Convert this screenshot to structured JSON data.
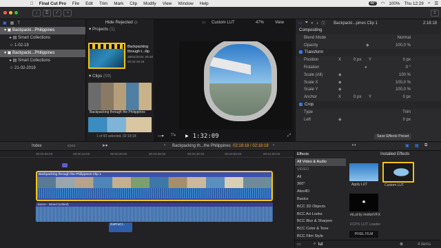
{
  "menubar": {
    "app": "Final Cut Pro",
    "items": [
      "File",
      "Edit",
      "Trim",
      "Mark",
      "Clip",
      "Modify",
      "View",
      "Window",
      "Help"
    ],
    "battery": "44°",
    "zoom": "100%",
    "clock": "Thu 12:29"
  },
  "library": {
    "items": [
      "Backpacki...Philippines",
      "Smart Collections",
      "1-02-19",
      "Backpacki...Philippines",
      "Smart Collections",
      "21-02-2019"
    ]
  },
  "browser": {
    "filter": "Hide Rejected",
    "projects_label": "Projects",
    "projects_count": "(1)",
    "project": {
      "name": "Backpacking through t...ilip",
      "date": "28/02/2019, 06:30",
      "duration": "00:02:18:18"
    },
    "clips_label": "Clips",
    "clips_count": "(59)",
    "clip_label": "Backpacking through the Philippines",
    "selection_info": "1 of 60 selected, 02:18:18"
  },
  "viewer": {
    "title": "Custom LUT",
    "zoom": "47%",
    "view": "View",
    "timecode": "1:32:09"
  },
  "inspector": {
    "clip_title": "Backpacki...pines Clip 1",
    "duration": "2:18:18",
    "compositing": "Compositing",
    "blend_mode_label": "Blend Mode",
    "blend_mode_value": "Normal",
    "opacity_label": "Opacity",
    "opacity_value": "100,0 %",
    "transform": "Transform",
    "position_label": "Position",
    "x_label": "X",
    "x_val": "0 px",
    "y_label": "Y",
    "y_val": "0 px",
    "rotation_label": "Rotation",
    "rotation_val": "0 °",
    "scale_all_label": "Scale (All)",
    "scale_all_val": "100 %",
    "scale_x_label": "Scale X",
    "scale_x_val": "100,0 %",
    "scale_y_label": "Scale Y",
    "scale_y_val": "100,0 %",
    "anchor_label": "Anchor",
    "anchor_x": "0 px",
    "anchor_y": "0 px",
    "crop": "Crop",
    "type_label": "Type",
    "type_val": "Trim",
    "left_label": "Left",
    "left_val": "0 px",
    "save_preset": "Save Effects Preset"
  },
  "timeline": {
    "index": "Index",
    "project": "Backpacking th...the Philippines",
    "timecode": "02:18:18 / 02:18:18",
    "clip_name": "Backpacking through the Philippines Clip 1",
    "audio_name": "Janoo - Island (edited)",
    "connected": "GoProCl...",
    "ruler": [
      "00:00:00:00",
      "00:00:10:00",
      "00:00:20:00",
      "00:00:30:00",
      "00:00:40:00",
      "00:00:50:00",
      "00:01:00:00"
    ]
  },
  "effects": {
    "header": "Effects",
    "installed": "Installed Effects",
    "categories": [
      "All Video & Audio",
      "VIDEO",
      "All",
      "360°",
      "Alex4D",
      "Basics",
      "BCC 3D Objects",
      "BCC Art Looks",
      "BCC Blur & Sharpen",
      "BCC Color & Tone",
      "BCC Film Style"
    ],
    "items": [
      "Apply LUT",
      "Custom LUT",
      "mLut by motionVFX"
    ],
    "group": "FCPX LUT Loader",
    "pixel_film": "PIXEL FILM",
    "search": "lut",
    "count": "4 items"
  },
  "colors": {
    "accent": "#2f7bf5",
    "selection": "#f5c518",
    "clip_blue": "#3f4fb0",
    "audio": "#3a8fd6"
  }
}
